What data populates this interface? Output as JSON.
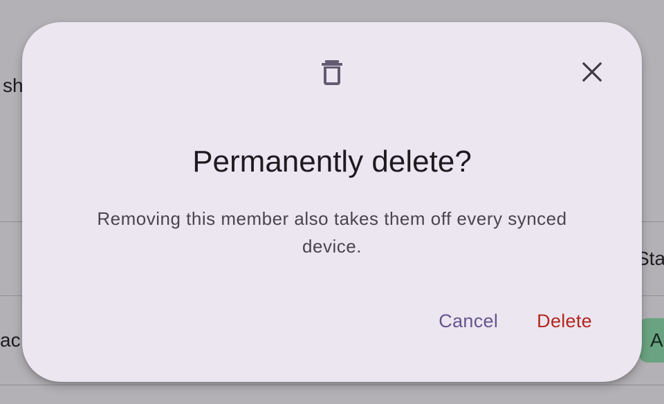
{
  "background": {
    "fragment_top": "sh",
    "fragment_mid_right": "Sta",
    "fragment_bottom_left": "ac",
    "chip_label": "Ac"
  },
  "dialog": {
    "hero_icon": "delete-icon",
    "close_icon": "close-icon",
    "title": "Permanently delete?",
    "body": "Removing this member also takes them off every synced device.",
    "cancel_label": "Cancel",
    "delete_label": "Delete"
  },
  "colors": {
    "scrim": "#1d1b20",
    "surface": "#ece6f0",
    "primary": "#65558f",
    "error": "#b3261e",
    "icon": "#625b71"
  }
}
